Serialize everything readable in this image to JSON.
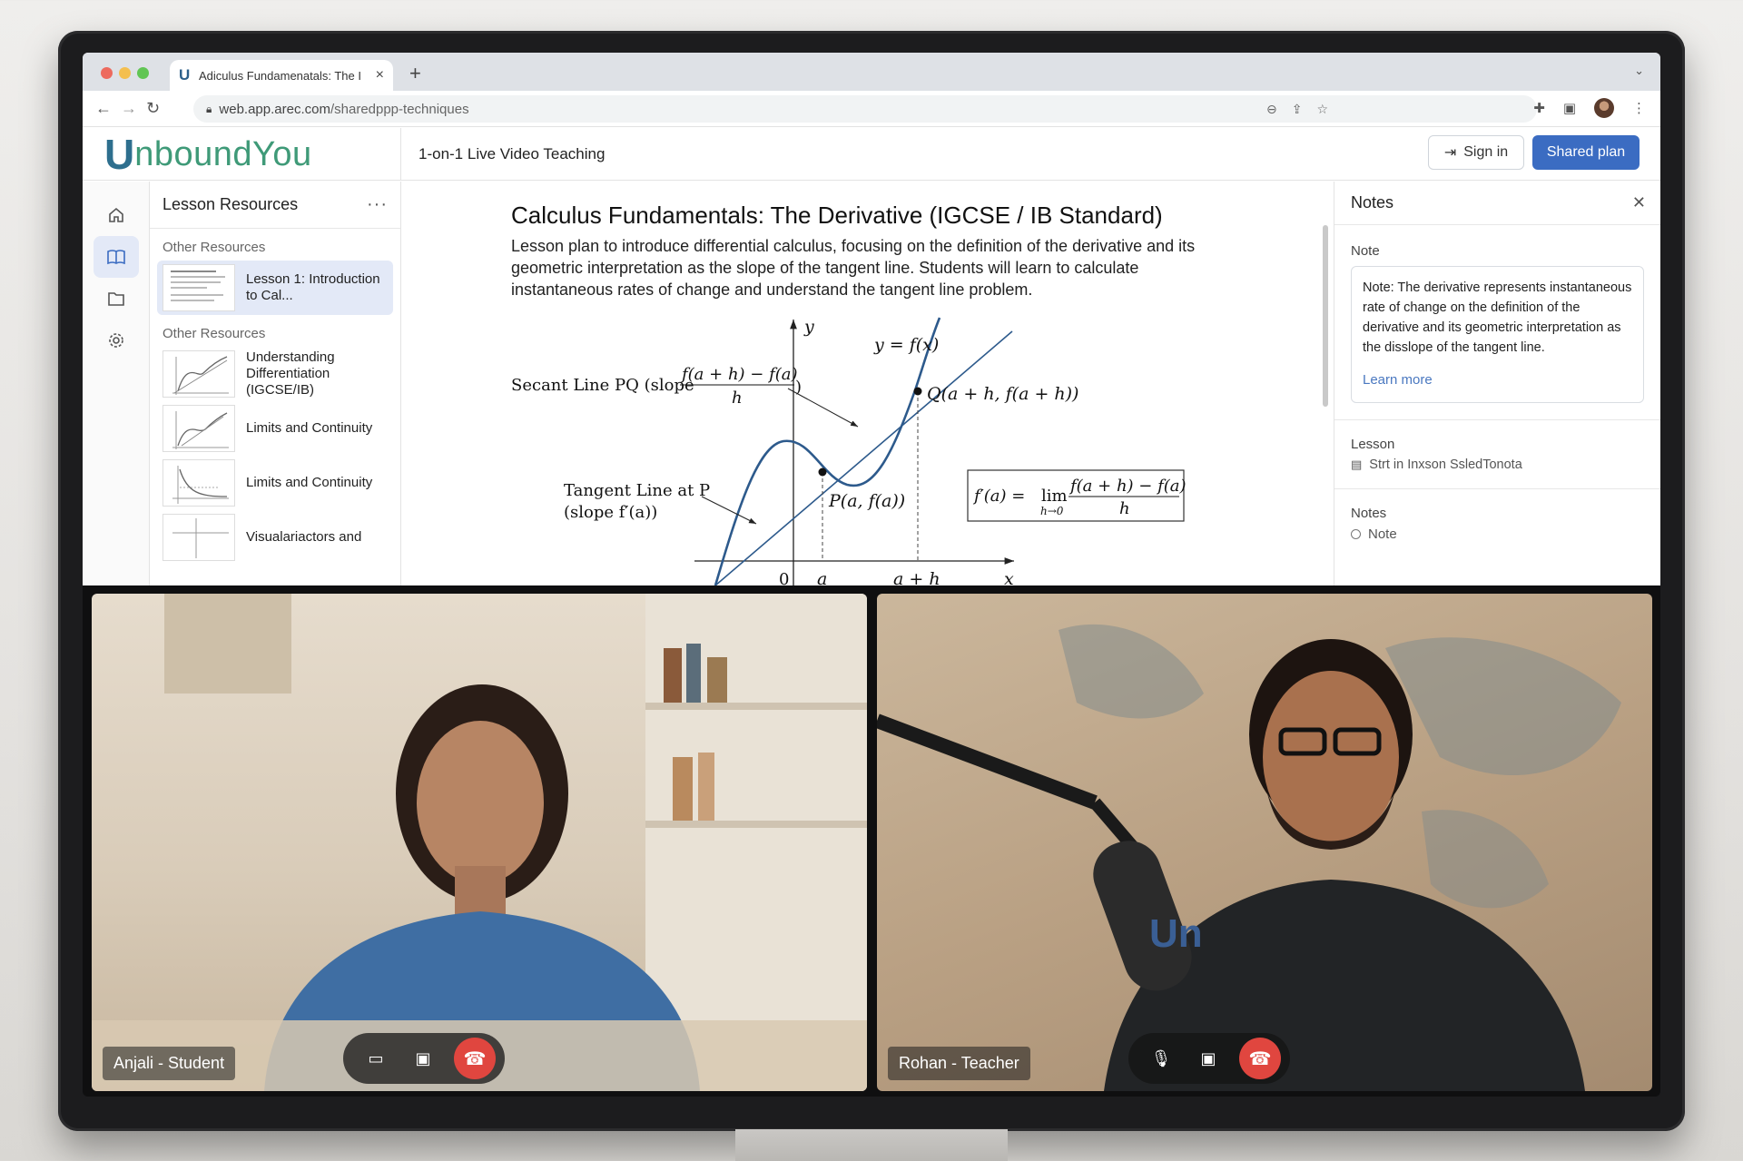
{
  "browser": {
    "tab_title": "Adiculus Fundamenatals: The I",
    "tab_logo": "U",
    "new_tab": "+",
    "url_domain": "web.app.arec.com",
    "url_path": "/sharedppp-techniques"
  },
  "app": {
    "logo_u": "U",
    "logo_rest": "nboundYou",
    "header_title": "1-on-1 Live Video Teaching",
    "signin_label": "Sign in",
    "shared_label": "Shared plan"
  },
  "rail": {
    "items": [
      "home-icon",
      "book-icon",
      "folder-icon",
      "gear-icon"
    ],
    "active_index": 1
  },
  "resources": {
    "title": "Lesson Resources",
    "more": "···",
    "section1": "Other Resources",
    "selected_item": "Lesson 1: Introduction to Cal...",
    "section2": "Other Resources",
    "items": [
      "Understanding Differentiation (IGCSE/IB)",
      "Limits and Continuity",
      "Limits and Continuity",
      "Visualariactors and"
    ]
  },
  "lesson": {
    "title": "Calculus Fundamentals: The Derivative (IGCSE / IB Standard)",
    "description": "Lesson plan to introduce differential calculus, focusing on the definition of the derivative and its geometric interpretation as the slope of the tangent line. Students will learn to calculate instantaneous rates of change and understand the tangent line problem."
  },
  "diagram": {
    "y_axis": "y",
    "x_axis": "x",
    "origin": "0",
    "tick_a": "a",
    "tick_ah": "a + h",
    "curve_label": "y = f(x)",
    "secant_prefix": "Secant Line PQ (slope",
    "secant_num": "f(a + h) − f(a)",
    "secant_den": "h",
    "secant_close": ")",
    "tangent_line1": "Tangent Line at P",
    "tangent_line2": "(slope f′(a))",
    "point_p": "P(a, f(a))",
    "point_q": "Q(a + h, f(a + h))",
    "formula_lhs": "f′(a) = ",
    "formula_lim": "lim",
    "formula_sub": "h→0",
    "formula_num": "f(a + h) − f(a)",
    "formula_den": "h"
  },
  "notes": {
    "title": "Notes",
    "note_label": "Note",
    "note_text": "Note: The derivative represents instantaneous rate of change on the definition of the derivative and its geometric interpretation as the disslope of the tangent line.",
    "learn_more": "Learn more",
    "lesson_label": "Lesson",
    "lesson_ref": "Strt in Inxson SsledTonota",
    "notes_label": "Notes",
    "notes_item": "Note"
  },
  "video": {
    "student_name": "Anjali - Student",
    "teacher_name": "Rohan - Teacher",
    "shirt_logo": "Un"
  }
}
